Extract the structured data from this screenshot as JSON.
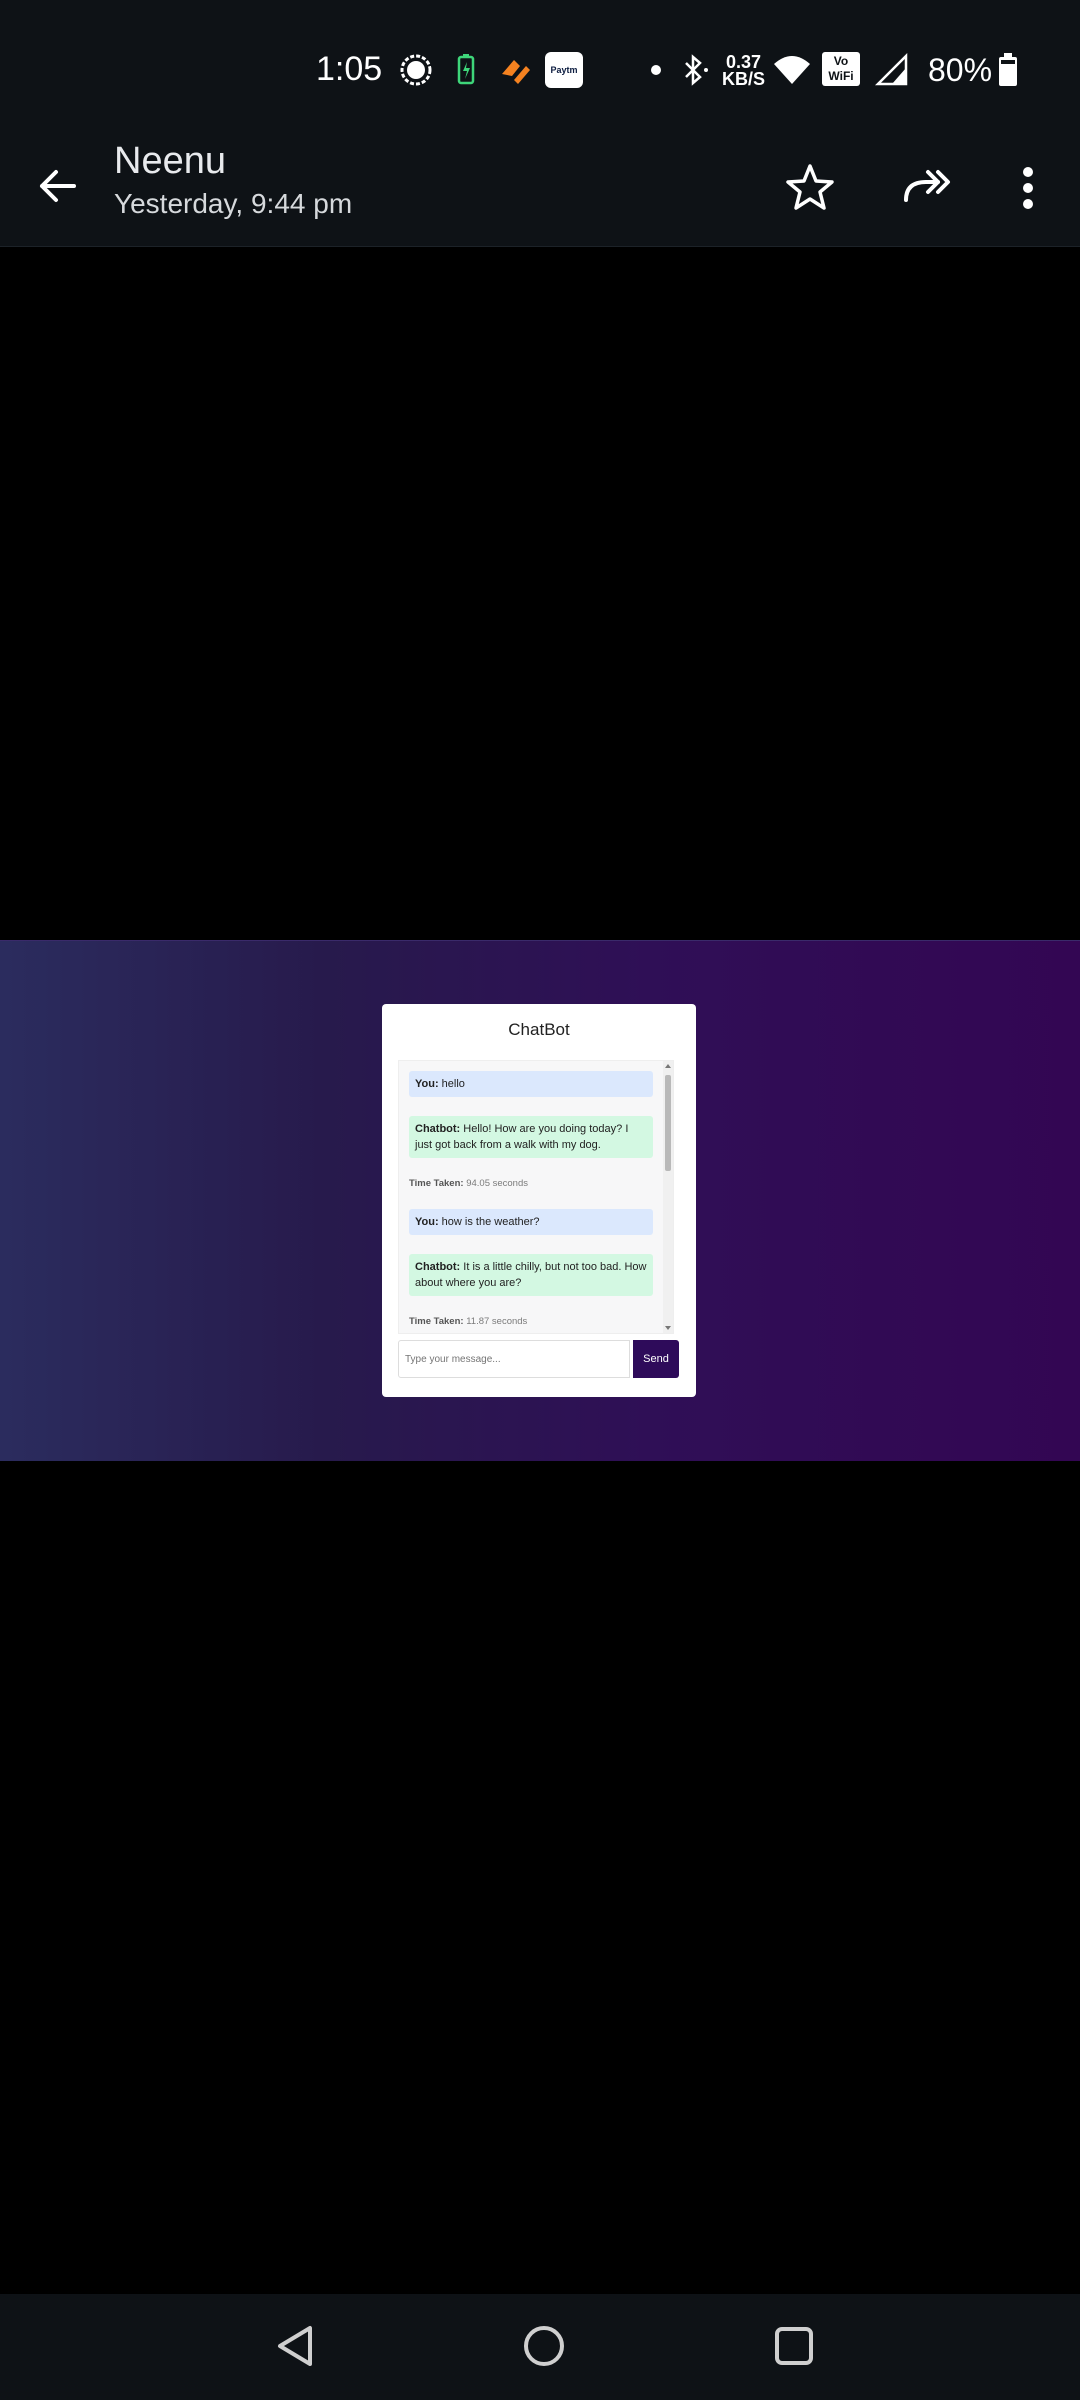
{
  "status_bar": {
    "time": "1:05",
    "net_speed_value": "0.37",
    "net_speed_unit": "KB/S",
    "battery_percent": "80%",
    "paytm_label": "Paytm",
    "vowifi_top": "Vo",
    "vowifi_bottom": "WiFi"
  },
  "header": {
    "contact_name": "Neenu",
    "timestamp": "Yesterday, 9:44 pm"
  },
  "chatbot": {
    "title": "ChatBot",
    "messages": [
      {
        "sender": "You:",
        "text": " hello"
      },
      {
        "sender": "Chatbot:",
        "text": " Hello! How are you doing today? I just got back from a walk with my dog."
      },
      {
        "label": "Time Taken:",
        "value": " 94.05 seconds"
      },
      {
        "sender": "You:",
        "text": " how is the weather?"
      },
      {
        "sender": "Chatbot:",
        "text": " It is a little chilly, but not too bad. How about where you are?"
      },
      {
        "label": "Time Taken:",
        "value": " 11.87 seconds"
      }
    ],
    "input_placeholder": "Type your message...",
    "send_label": "Send"
  },
  "colors": {
    "header_bg": "#0e1216",
    "user_bubble": "#dbe8fd",
    "bot_bubble": "#d3f8e2",
    "send_button": "#2e0b5a",
    "gradient_left": "#2b2c5e",
    "gradient_right": "#330653"
  },
  "icons": [
    "back-arrow-icon",
    "star-icon",
    "forward-icon",
    "more-vert-icon",
    "nav-back-icon",
    "nav-home-icon",
    "nav-recents-icon"
  ]
}
